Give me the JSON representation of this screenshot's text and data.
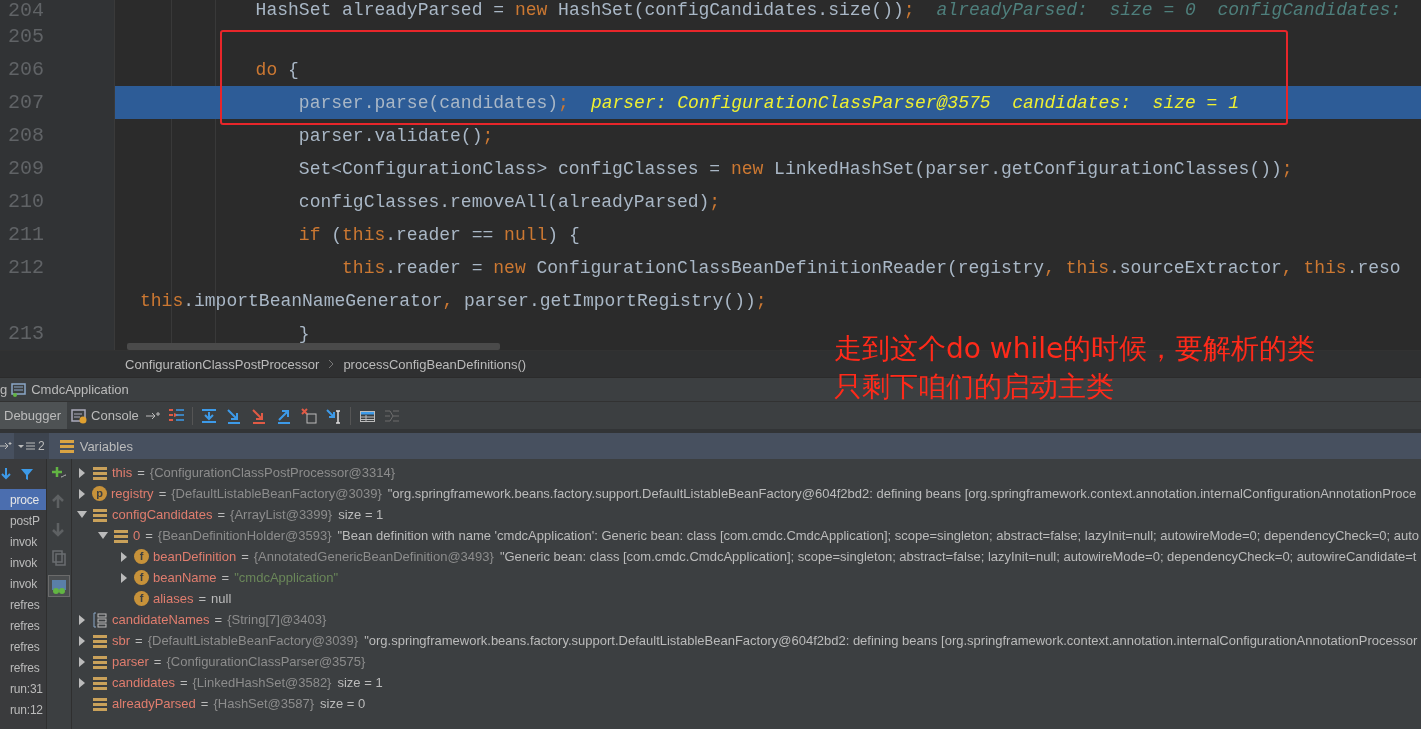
{
  "editor": {
    "lines": [
      {
        "number": "204",
        "selected": false,
        "code": [
          {
            "kind": "plain",
            "text": "            HashSet alreadyParsed = "
          },
          {
            "kind": "kw",
            "text": "new"
          },
          {
            "kind": "plain",
            "text": " HashSet(configCandidates.size())"
          },
          {
            "kind": "kw",
            "text": ";"
          }
        ],
        "hint": "alreadyParsed:  size = 0  configCandidates:"
      },
      {
        "number": "205",
        "selected": false
      },
      {
        "number": "206",
        "selected": false,
        "code": [
          {
            "kind": "kw",
            "text": "            do"
          },
          {
            "kind": "plain",
            "text": " {"
          }
        ]
      },
      {
        "number": "207",
        "selected": true,
        "code": [
          {
            "kind": "plain",
            "text": "                parser.parse(candidates)"
          },
          {
            "kind": "kw",
            "text": ";"
          }
        ],
        "hint": "parser: ConfigurationClassParser@3575  candidates:  size = 1"
      },
      {
        "number": "208",
        "selected": false,
        "code": [
          {
            "kind": "plain",
            "text": "                parser.validate()"
          },
          {
            "kind": "kw",
            "text": ";"
          }
        ]
      },
      {
        "number": "209",
        "selected": false,
        "code": [
          {
            "kind": "plain",
            "text": "                Set<ConfigurationClass> configClasses = "
          },
          {
            "kind": "kw",
            "text": "new"
          },
          {
            "kind": "plain",
            "text": " LinkedHashSet(parser.getConfigurationClasses())"
          },
          {
            "kind": "kw",
            "text": ";"
          }
        ]
      },
      {
        "number": "210",
        "selected": false,
        "code": [
          {
            "kind": "plain",
            "text": "                configClasses.removeAll(alreadyParsed)"
          },
          {
            "kind": "kw",
            "text": ";"
          }
        ]
      },
      {
        "number": "211",
        "selected": false,
        "code": [
          {
            "kind": "kw",
            "text": "                if"
          },
          {
            "kind": "plain",
            "text": " ("
          },
          {
            "kind": "kw",
            "text": "this"
          },
          {
            "kind": "plain",
            "text": ".reader == "
          },
          {
            "kind": "kw",
            "text": "null"
          },
          {
            "kind": "plain",
            "text": ") {"
          }
        ]
      },
      {
        "number": "212",
        "selected": false,
        "code": [
          {
            "kind": "kw",
            "text": "                    this"
          },
          {
            "kind": "plain",
            "text": ".reader = "
          },
          {
            "kind": "kw",
            "text": "new"
          },
          {
            "kind": "plain",
            "text": " ConfigurationClassBeanDefinitionReader(registry"
          },
          {
            "kind": "kw",
            "text": ", this"
          },
          {
            "kind": "plain",
            "text": ".sourceExtractor"
          },
          {
            "kind": "kw",
            "text": ", this"
          },
          {
            "kind": "plain",
            "text": ".reso"
          }
        ]
      },
      {
        "selected": false,
        "code": [
          {
            "kind": "kw",
            "text": "this"
          },
          {
            "kind": "plain",
            "text": ".importBeanNameGenerator"
          },
          {
            "kind": "kw",
            "text": ","
          },
          {
            "kind": "plain",
            "text": " parser.getImportRegistry())"
          },
          {
            "kind": "kw",
            "text": ";"
          }
        ]
      },
      {
        "number": "213",
        "selected": false,
        "code": [
          {
            "kind": "plain",
            "text": "                }"
          }
        ]
      }
    ]
  },
  "breadcrumbs": [
    "ConfigurationClassPostProcessor",
    "processConfigBeanDefinitions()"
  ],
  "annotation": [
    "走到这个do while的时候，要解析的类",
    "只剩下咱们的启动主类"
  ],
  "debug": {
    "title_prefix": "g",
    "title": "CmdcApplication",
    "tabs": [
      {
        "label": "Debugger",
        "selected": true
      },
      {
        "label": "Console",
        "selected": false
      }
    ],
    "toolbar": [
      {
        "disabled": false
      },
      {
        "disabled": false
      },
      {
        "disabled": false
      },
      {
        "disabled": false
      },
      {
        "disabled": false
      },
      {
        "disabled": false
      },
      {
        "disabled": false
      },
      {
        "disabled": false
      },
      {
        "disabled": true
      }
    ],
    "threads_count": "2",
    "variables_title": "Variables",
    "frames": [
      {
        "label": "proce",
        "selected": true
      },
      {
        "label": "postP",
        "selected": false
      },
      {
        "label": "invok",
        "selected": false
      },
      {
        "label": "invok",
        "selected": false
      },
      {
        "label": "invok",
        "selected": false
      },
      {
        "label": "refres",
        "selected": false
      },
      {
        "label": "refres",
        "selected": false
      },
      {
        "label": "refres",
        "selected": false
      },
      {
        "label": "refres",
        "selected": false
      },
      {
        "label": "run:31",
        "selected": false
      },
      {
        "label": "run:12",
        "selected": false
      }
    ],
    "side_tools": [
      {
        "disabled": false,
        "selected": false
      },
      {
        "disabled": true,
        "selected": false
      },
      {
        "disabled": true,
        "selected": false
      },
      {
        "disabled": true,
        "selected": false
      },
      {
        "disabled": false,
        "selected": true
      }
    ],
    "variables": [
      {
        "name": "this",
        "kind": "field",
        "expandable": true,
        "expanded": false,
        "equals": "=",
        "type": "{ConfigurationClassPostProcessor@3314}"
      },
      {
        "name": "registry",
        "kind": "letter",
        "badge": "p",
        "expandable": true,
        "expanded": false,
        "equals": "=",
        "type": "{DefaultListableBeanFactory@3039}",
        "value": "\"org.springframework.beans.factory.support.DefaultListableBeanFactory@604f2bd2: defining beans [org.springframework.context.annotation.internalConfigurationAnnotationProce"
      },
      {
        "name": "configCandidates",
        "kind": "field",
        "expandable": true,
        "expanded": true,
        "equals": "=",
        "type": "{ArrayList@3399}",
        "value": "size = 1",
        "children": [
          {
            "name": "0",
            "kind": "field",
            "expandable": true,
            "expanded": true,
            "equals": "=",
            "type": "{BeanDefinitionHolder@3593}",
            "value": "\"Bean definition with name 'cmdcApplication': Generic bean: class [com.cmdc.CmdcApplication]; scope=singleton; abstract=false; lazyInit=null; autowireMode=0; dependencyCheck=0; auto",
            "children": [
              {
                "name": "beanDefinition",
                "kind": "letter",
                "badge": "f",
                "expandable": true,
                "expanded": false,
                "equals": "=",
                "type": "{AnnotatedGenericBeanDefinition@3493}",
                "value": "\"Generic bean: class [com.cmdc.CmdcApplication]; scope=singleton; abstract=false; lazyInit=null; autowireMode=0; dependencyCheck=0; autowireCandidate=t"
              },
              {
                "name": "beanName",
                "kind": "letter",
                "badge": "f",
                "expandable": true,
                "expanded": false,
                "equals": "=",
                "string": "\"cmdcApplication\""
              },
              {
                "name": "aliases",
                "kind": "letter",
                "badge": "f",
                "expandable": false,
                "equals": "=",
                "value": "null"
              }
            ]
          }
        ]
      },
      {
        "name": "candidateNames",
        "kind": "array",
        "expandable": true,
        "expanded": false,
        "equals": "=",
        "type": "{String[7]@3403}"
      },
      {
        "name": "sbr",
        "kind": "field",
        "expandable": true,
        "expanded": false,
        "equals": "=",
        "type": "{DefaultListableBeanFactory@3039}",
        "value": "\"org.springframework.beans.factory.support.DefaultListableBeanFactory@604f2bd2: defining beans [org.springframework.context.annotation.internalConfigurationAnnotationProcessor"
      },
      {
        "name": "parser",
        "kind": "field",
        "expandable": true,
        "expanded": false,
        "equals": "=",
        "type": "{ConfigurationClassParser@3575}"
      },
      {
        "name": "candidates",
        "kind": "field",
        "expandable": true,
        "expanded": false,
        "equals": "=",
        "type": "{LinkedHashSet@3582}",
        "value": "size = 1"
      },
      {
        "name": "alreadyParsed",
        "kind": "field",
        "expandable": false,
        "equals": "=",
        "type": "{HashSet@3587}",
        "value": "size = 0"
      }
    ]
  }
}
